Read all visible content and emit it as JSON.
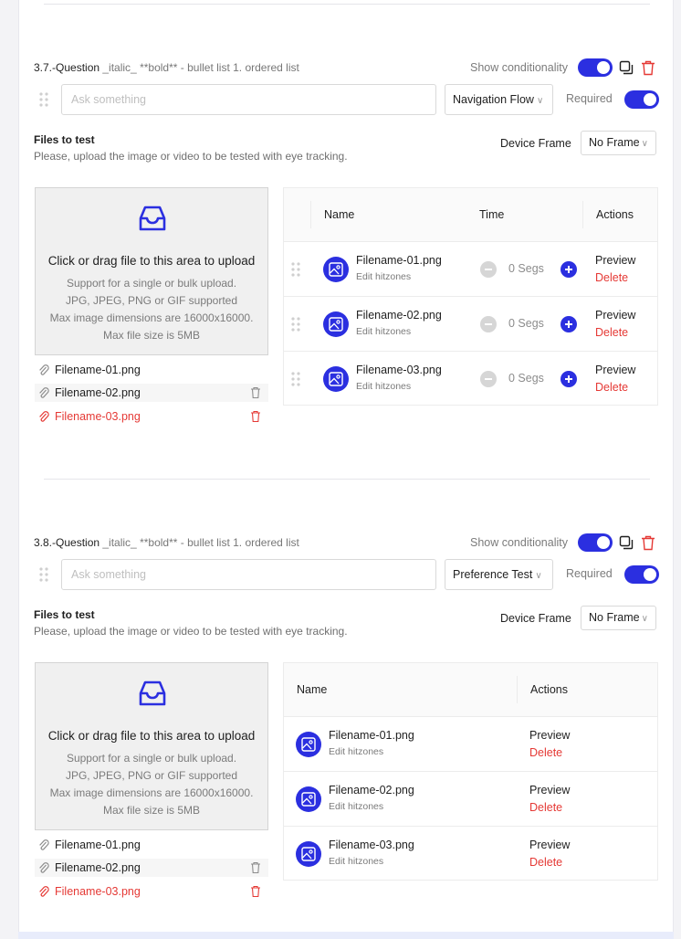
{
  "q1": {
    "title_num": "3.7.-Question",
    "title_md": " _italic_ **bold** - bullet list 1. ordered list",
    "show_conditionality": "Show conditionality",
    "input_placeholder": "Ask something",
    "type_select": "Navigation Flow",
    "required": "Required",
    "files_title": "Files to test",
    "files_sub": "Please, upload the image or video to be tested with eye tracking.",
    "device_frame_label": "Device Frame",
    "device_frame_value": "No Frame",
    "upload": {
      "title": "Click or drag file to this area to upload",
      "line1": "Support for a single or bulk upload.",
      "line2": "JPG, JPEG, PNG or GIF supported",
      "line3": "Max image dimensions are 16000x16000.",
      "line4": "Max file size is 5MB"
    },
    "uploaded_files": [
      "Filename-01.png",
      "Filename-02.png",
      "Filename-03.png"
    ],
    "table": {
      "col_name": "Name",
      "col_time": "Time",
      "col_actions": "Actions",
      "rows": [
        {
          "name": "Filename-01.png",
          "sub": "Edit hitzones",
          "time": "0 Segs",
          "preview": "Preview",
          "delete": "Delete"
        },
        {
          "name": "Filename-02.png",
          "sub": "Edit hitzones",
          "time": "0 Segs",
          "preview": "Preview",
          "delete": "Delete"
        },
        {
          "name": "Filename-03.png",
          "sub": "Edit hitzones",
          "time": "0 Segs",
          "preview": "Preview",
          "delete": "Delete"
        }
      ]
    }
  },
  "q2": {
    "title_num": "3.8.-Question",
    "title_md": " _italic_ **bold** - bullet list 1. ordered list",
    "show_conditionality": "Show conditionality",
    "input_placeholder": "Ask something",
    "type_select": "Preference Test",
    "required": "Required",
    "files_title": "Files to test",
    "files_sub": "Please, upload the image or video to be tested with eye tracking.",
    "device_frame_label": "Device Frame",
    "device_frame_value": "No Frame",
    "upload": {
      "title": "Click or drag file to this area to upload",
      "line1": "Support for a single or bulk upload.",
      "line2": "JPG, JPEG, PNG or GIF supported",
      "line3": "Max image dimensions are 16000x16000.",
      "line4": "Max file size is 5MB"
    },
    "uploaded_files": [
      "Filename-01.png",
      "Filename-02.png",
      "Filename-03.png"
    ],
    "table": {
      "col_name": "Name",
      "col_actions": "Actions",
      "rows": [
        {
          "name": "Filename-01.png",
          "sub": "Edit hitzones",
          "preview": "Preview",
          "delete": "Delete"
        },
        {
          "name": "Filename-02.png",
          "sub": "Edit hitzones",
          "preview": "Preview",
          "delete": "Delete"
        },
        {
          "name": "Filename-03.png",
          "sub": "Edit hitzones",
          "preview": "Preview",
          "delete": "Delete"
        }
      ]
    }
  },
  "colors": {
    "accent": "#2b2fe0",
    "danger": "#e53935"
  }
}
